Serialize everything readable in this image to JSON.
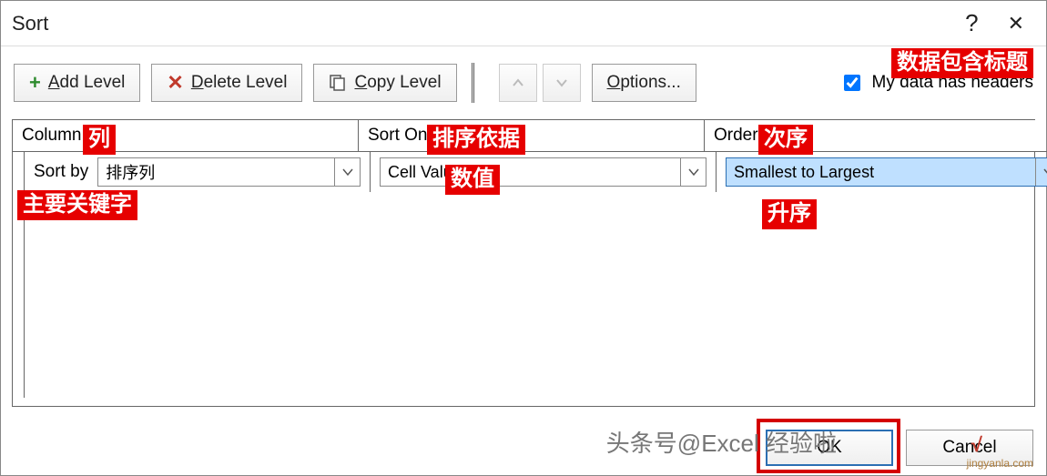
{
  "dialog": {
    "title": "Sort",
    "help_tooltip": "?",
    "close_tooltip": "✕"
  },
  "toolbar": {
    "add_level": "Add Level",
    "delete_level": "Delete Level",
    "copy_level": "Copy Level",
    "options": "Options...",
    "my_data_has_headers": "My data has headers",
    "headers_checked": true
  },
  "columns": {
    "column_header": "Column",
    "sort_on_header": "Sort On",
    "order_header": "Order"
  },
  "row": {
    "sort_by_label": "Sort by",
    "column_value": "排序列",
    "sort_on_value": "Cell Values",
    "order_value": "Smallest to Largest"
  },
  "footer": {
    "ok": "OK",
    "cancel": "Cancel"
  },
  "annotations": {
    "headers_anno": "数据包含标题",
    "column_anno": "列",
    "sort_on_anno": "排序依据",
    "order_anno": "次序",
    "sort_by_anno": "主要关键字",
    "values_anno": "数值",
    "asc_anno": "升序"
  },
  "watermark": {
    "main": "头条号@Excel 经验啦",
    "sub": "jingyanla.com",
    "badge": "√"
  }
}
